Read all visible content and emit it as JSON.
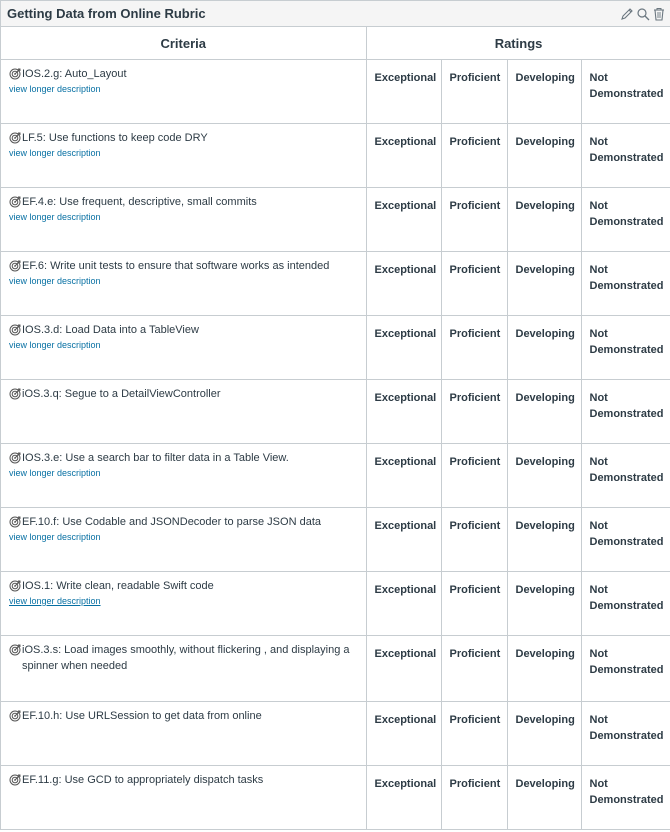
{
  "rubric": {
    "title": "Getting Data from Online Rubric",
    "tools": [
      "edit-icon",
      "search-icon",
      "trash-icon"
    ],
    "headers": {
      "criteria": "Criteria",
      "ratings": "Ratings"
    },
    "long_desc_label": "view longer description",
    "rating_labels": [
      "Exceptional",
      "Proficient",
      "Developing",
      "Not Demonstrated"
    ],
    "criteria": [
      {
        "text": "IOS.2.g: Auto_Layout",
        "has_desc": true
      },
      {
        "text": "LF.5: Use functions to keep code DRY",
        "has_desc": true
      },
      {
        "text": "EF.4.e: Use frequent, descriptive, small commits",
        "has_desc": true
      },
      {
        "text": "EF.6: Write unit tests to ensure that software works as intended",
        "has_desc": true
      },
      {
        "text": "IOS.3.d: Load Data into a TableView",
        "has_desc": true
      },
      {
        "text": "iOS.3.q: Segue to a DetailViewController",
        "has_desc": false
      },
      {
        "text": "IOS.3.e: Use a search bar to filter data in a Table View.",
        "has_desc": true
      },
      {
        "text": "EF.10.f: Use Codable and JSONDecoder to parse JSON data",
        "has_desc": true
      },
      {
        "text": "IOS.1: Write clean, readable Swift code",
        "has_desc": true,
        "underlined": true
      },
      {
        "text": "iOS.3.s: Load images smoothly, without flickering , and displaying a spinner when needed",
        "has_desc": false
      },
      {
        "text": "EF.10.h: Use URLSession to get data from online",
        "has_desc": false
      },
      {
        "text": "EF.11.g: Use GCD to appropriately dispatch tasks",
        "has_desc": false
      }
    ]
  },
  "colors": {
    "link": "#0770a3",
    "border": "#c7cdd1",
    "text": "#2d3b45"
  }
}
